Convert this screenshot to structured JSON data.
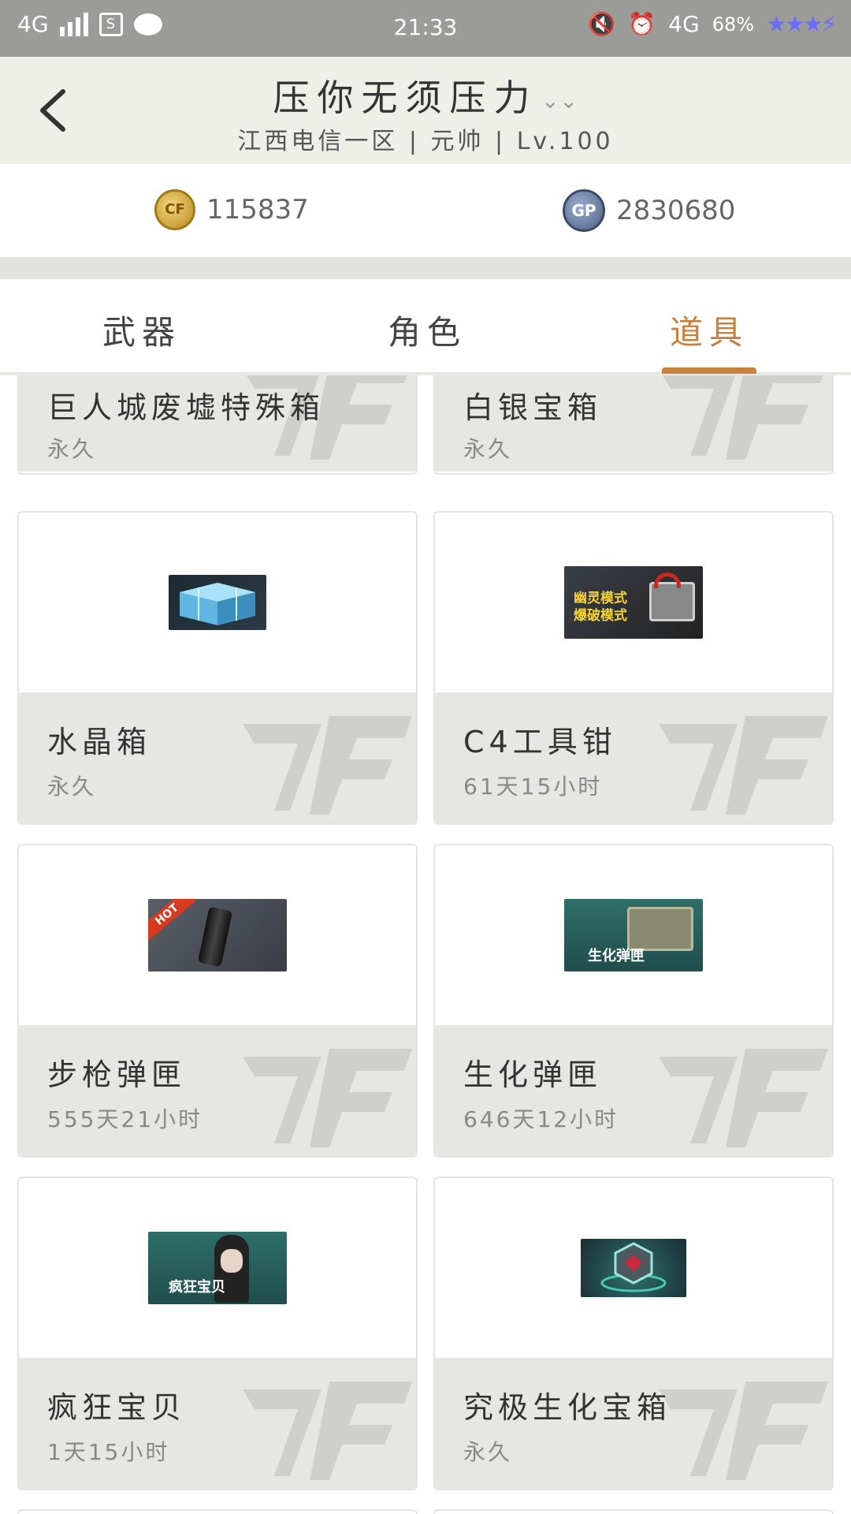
{
  "status_bar": {
    "network": "4G",
    "time": "21:33",
    "network_right": "4G",
    "battery": "68%"
  },
  "header": {
    "title": "压你无须压力",
    "subtitle": "江西电信一区 | 元帅 | Lv.100"
  },
  "currency": {
    "cf_value": "115837",
    "gp_value": "2830680",
    "cf_icon": "CF",
    "gp_icon": "GP"
  },
  "tabs": [
    {
      "label": "武器",
      "active": false
    },
    {
      "label": "角色",
      "active": false
    },
    {
      "label": "道具",
      "active": true
    }
  ],
  "accent_color": "#c7813d",
  "items": [
    {
      "name": "巨人城废墟特殊箱",
      "duration": "永久"
    },
    {
      "name": "白银宝箱",
      "duration": "永久"
    },
    {
      "name": "水晶箱",
      "duration": "永久"
    },
    {
      "name": "C4工具钳",
      "duration": "61天15小时",
      "thumb_text": [
        "幽灵模式",
        "爆破模式"
      ]
    },
    {
      "name": "步枪弹匣",
      "duration": "555天21小时",
      "thumb_text": [
        "HOT"
      ]
    },
    {
      "name": "生化弹匣",
      "duration": "646天12小时",
      "thumb_text": [
        "生化弹匣"
      ]
    },
    {
      "name": "疯狂宝贝",
      "duration": "1天15小时",
      "thumb_text": [
        "疯狂宝贝"
      ]
    },
    {
      "name": "究极生化宝箱",
      "duration": "永久"
    }
  ]
}
